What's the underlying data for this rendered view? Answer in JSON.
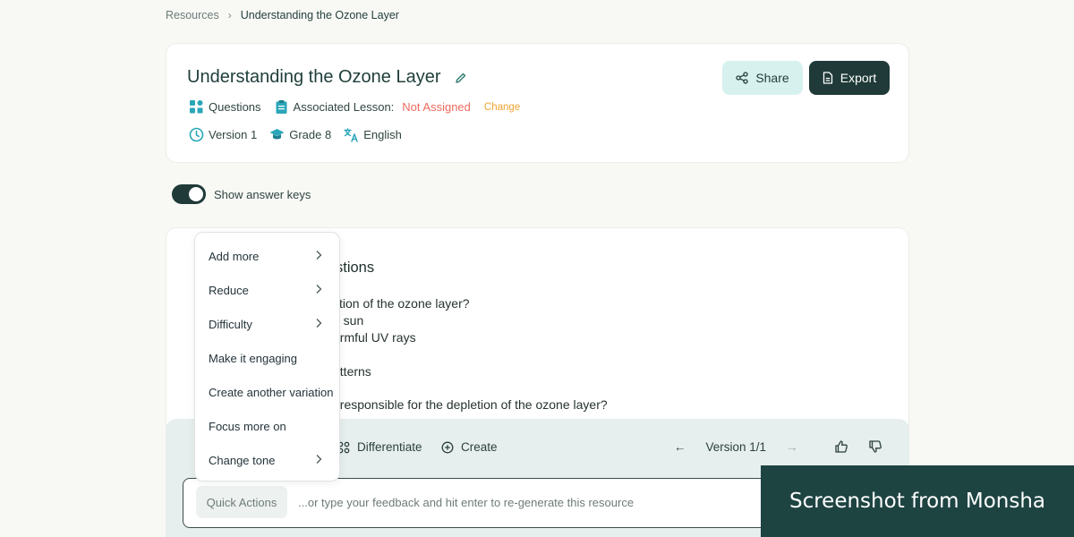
{
  "breadcrumb": {
    "root": "Resources",
    "current": "Understanding the Ozone Layer"
  },
  "header": {
    "title": "Understanding the Ozone Layer",
    "type_label": "Questions",
    "lesson_label": "Associated Lesson:",
    "lesson_value": "Not Assigned",
    "change_label": "Change",
    "version": "Version 1",
    "grade": "Grade 8",
    "language": "English",
    "share_label": "Share",
    "export_label": "Export"
  },
  "toggle": {
    "label": "Show answer keys",
    "on": true
  },
  "content": {
    "section_title_fragment": "stions",
    "lines": [
      "ction of the ozone layer?",
      "e sun",
      "armful UV rays",
      "atterns",
      "t responsible for the depletion of the ozone layer?"
    ]
  },
  "toolbar": {
    "differentiate_label": "Differentiate",
    "create_label": "Create",
    "version_label": "Version 1/1",
    "quick_actions_label": "Quick Actions",
    "feedback_placeholder": "...or type your feedback and hit enter to re-generate this resource"
  },
  "menu": {
    "items": [
      {
        "label": "Add more",
        "has_submenu": true
      },
      {
        "label": "Reduce",
        "has_submenu": true
      },
      {
        "label": "Difficulty",
        "has_submenu": true
      },
      {
        "label": "Make it engaging",
        "has_submenu": false
      },
      {
        "label": "Create another variation",
        "has_submenu": false
      },
      {
        "label": "Focus more on",
        "has_submenu": false
      },
      {
        "label": "Change tone",
        "has_submenu": true
      }
    ]
  },
  "watermark": {
    "text": "Screenshot from Monsha"
  },
  "colors": {
    "primary_dark": "#1f3a38",
    "accent_light": "#d7f1ef",
    "warning_red": "#ee6b5e",
    "change_orange": "#f0a330",
    "icon_teal": "#2aa6b8"
  }
}
